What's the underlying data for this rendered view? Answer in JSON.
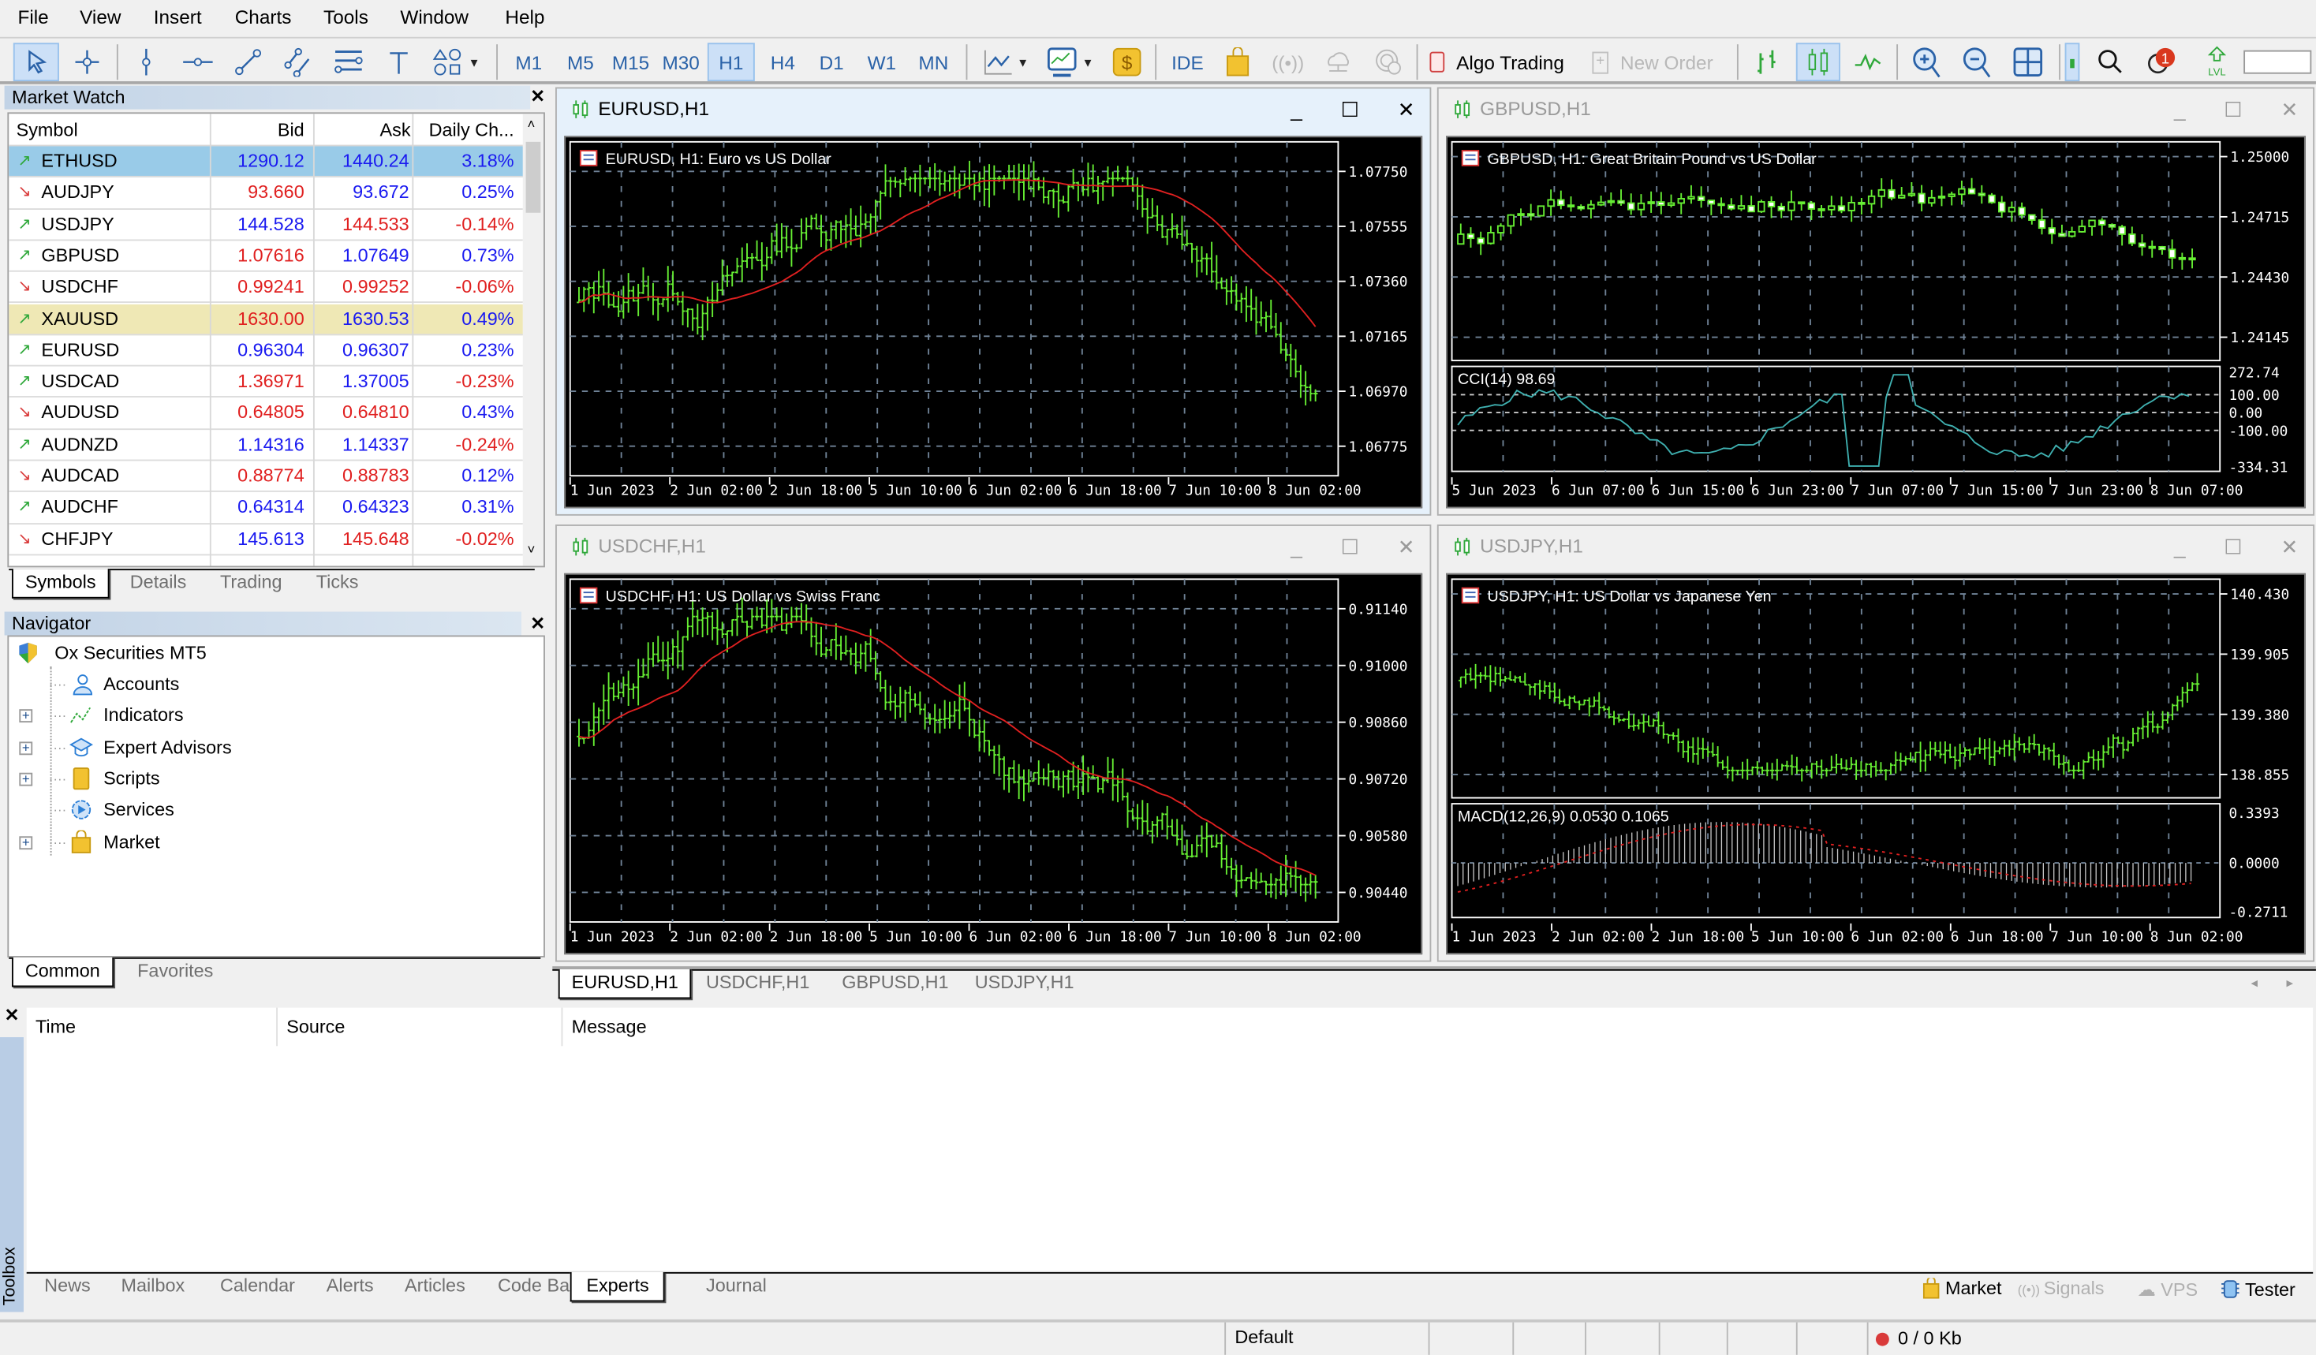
{
  "menu": [
    "File",
    "View",
    "Insert",
    "Charts",
    "Tools",
    "Window",
    "Help"
  ],
  "toolbar": {
    "timeframes": [
      "M1",
      "M5",
      "M15",
      "M30",
      "H1",
      "H4",
      "D1",
      "W1",
      "MN"
    ],
    "selected_timeframe": "H1",
    "ide_label": "IDE",
    "algo_trading_label": "Algo Trading",
    "new_order_label": "New Order",
    "notification_count": "1"
  },
  "market_watch": {
    "title": "Market Watch",
    "columns": [
      "Symbol",
      "Bid",
      "Ask",
      "Daily Ch..."
    ],
    "rows": [
      {
        "symbol": "ETHUSD",
        "dir": "up",
        "bid": "1290.12",
        "bid_c": "blue",
        "ask": "1440.24",
        "ask_c": "blue",
        "chg": "3.18%",
        "chg_c": "blue",
        "hl": "selected"
      },
      {
        "symbol": "AUDJPY",
        "dir": "down",
        "bid": "93.660",
        "bid_c": "red",
        "ask": "93.672",
        "ask_c": "blue",
        "chg": "0.25%",
        "chg_c": "blue",
        "hl": ""
      },
      {
        "symbol": "USDJPY",
        "dir": "up",
        "bid": "144.528",
        "bid_c": "blue",
        "ask": "144.533",
        "ask_c": "red",
        "chg": "-0.14%",
        "chg_c": "red",
        "hl": ""
      },
      {
        "symbol": "GBPUSD",
        "dir": "up",
        "bid": "1.07616",
        "bid_c": "red",
        "ask": "1.07649",
        "ask_c": "blue",
        "chg": "0.73%",
        "chg_c": "blue",
        "hl": ""
      },
      {
        "symbol": "USDCHF",
        "dir": "down",
        "bid": "0.99241",
        "bid_c": "red",
        "ask": "0.99252",
        "ask_c": "red",
        "chg": "-0.06%",
        "chg_c": "red",
        "hl": ""
      },
      {
        "symbol": "XAUUSD",
        "dir": "up",
        "bid": "1630.00",
        "bid_c": "red",
        "ask": "1630.53",
        "ask_c": "blue",
        "chg": "0.49%",
        "chg_c": "blue",
        "hl": "yellow"
      },
      {
        "symbol": "EURUSD",
        "dir": "up",
        "bid": "0.96304",
        "bid_c": "blue",
        "ask": "0.96307",
        "ask_c": "blue",
        "chg": "0.23%",
        "chg_c": "blue",
        "hl": ""
      },
      {
        "symbol": "USDCAD",
        "dir": "up",
        "bid": "1.36971",
        "bid_c": "red",
        "ask": "1.37005",
        "ask_c": "blue",
        "chg": "-0.23%",
        "chg_c": "red",
        "hl": ""
      },
      {
        "symbol": "AUDUSD",
        "dir": "down",
        "bid": "0.64805",
        "bid_c": "red",
        "ask": "0.64810",
        "ask_c": "red",
        "chg": "0.43%",
        "chg_c": "blue",
        "hl": ""
      },
      {
        "symbol": "AUDNZD",
        "dir": "up",
        "bid": "1.14316",
        "bid_c": "blue",
        "ask": "1.14337",
        "ask_c": "blue",
        "chg": "-0.24%",
        "chg_c": "red",
        "hl": ""
      },
      {
        "symbol": "AUDCAD",
        "dir": "down",
        "bid": "0.88774",
        "bid_c": "red",
        "ask": "0.88783",
        "ask_c": "red",
        "chg": "0.12%",
        "chg_c": "blue",
        "hl": ""
      },
      {
        "symbol": "AUDCHF",
        "dir": "up",
        "bid": "0.64314",
        "bid_c": "blue",
        "ask": "0.64323",
        "ask_c": "blue",
        "chg": "0.31%",
        "chg_c": "blue",
        "hl": ""
      },
      {
        "symbol": "CHFJPY",
        "dir": "down",
        "bid": "145.613",
        "bid_c": "blue",
        "ask": "145.648",
        "ask_c": "red",
        "chg": "-0.02%",
        "chg_c": "red",
        "hl": ""
      }
    ],
    "tabs": [
      "Symbols",
      "Details",
      "Trading",
      "Ticks"
    ],
    "active_tab": "Symbols"
  },
  "navigator": {
    "title": "Navigator",
    "root": "Ox Securities MT5",
    "items": [
      {
        "label": "Accounts",
        "expandable": false,
        "icon": "accounts-icon"
      },
      {
        "label": "Indicators",
        "expandable": true,
        "icon": "indicators-icon"
      },
      {
        "label": "Expert Advisors",
        "expandable": true,
        "icon": "expert-advisors-icon"
      },
      {
        "label": "Scripts",
        "expandable": true,
        "icon": "scripts-icon"
      },
      {
        "label": "Services",
        "expandable": false,
        "icon": "services-icon"
      },
      {
        "label": "Market",
        "expandable": true,
        "icon": "market-icon"
      }
    ],
    "tabs": [
      "Common",
      "Favorites"
    ],
    "active_tab": "Common"
  },
  "charts": [
    {
      "window_title": "EURUSD,H1",
      "active": true,
      "legend": "EURUSD, H1:  Euro vs US Dollar",
      "price_ticks": [
        "1.07750",
        "1.07555",
        "1.07360",
        "1.07165",
        "1.06970",
        "1.06775"
      ],
      "time_ticks": [
        "1 Jun 2023",
        "2 Jun 02:00",
        "2 Jun 18:00",
        "5 Jun 10:00",
        "6 Jun 02:00",
        "6 Jun 18:00",
        "7 Jun 10:00",
        "8 Jun 02:00"
      ],
      "style": "bars",
      "ma": true
    },
    {
      "window_title": "GBPUSD,H1",
      "active": false,
      "legend": "GBPUSD, H1:  Great Britain Pound vs US Dollar",
      "price_ticks": [
        "1.25000",
        "1.24715",
        "1.24430",
        "1.24145"
      ],
      "time_ticks": [
        "5 Jun 2023",
        "6 Jun 07:00",
        "6 Jun 15:00",
        "6 Jun 23:00",
        "7 Jun 07:00",
        "7 Jun 15:00",
        "7 Jun 23:00",
        "8 Jun 07:00"
      ],
      "style": "candles",
      "ma": false,
      "indicator": {
        "label": "CCI(14) 98.69",
        "ticks": [
          "272.74",
          "100.00",
          "0.00",
          "-100.00",
          "-334.31"
        ],
        "type": "cci"
      }
    },
    {
      "window_title": "USDCHF,H1",
      "active": false,
      "legend": "USDCHF, H1:  US Dollar vs Swiss Franc",
      "price_ticks": [
        "0.91140",
        "0.91000",
        "0.90860",
        "0.90720",
        "0.90580",
        "0.90440"
      ],
      "time_ticks": [
        "1 Jun 2023",
        "2 Jun 02:00",
        "2 Jun 18:00",
        "5 Jun 10:00",
        "6 Jun 02:00",
        "6 Jun 18:00",
        "7 Jun 10:00",
        "8 Jun 02:00"
      ],
      "style": "bars",
      "ma": true
    },
    {
      "window_title": "USDJPY,H1",
      "active": false,
      "legend": "USDJPY, H1:  US Dollar vs Japanese Yen",
      "price_ticks": [
        "140.430",
        "139.905",
        "139.380",
        "138.855"
      ],
      "time_ticks": [
        "1 Jun 2023",
        "2 Jun 02:00",
        "2 Jun 18:00",
        "5 Jun 10:00",
        "6 Jun 02:00",
        "6 Jun 18:00",
        "7 Jun 10:00",
        "8 Jun 02:00"
      ],
      "style": "bars",
      "ma": false,
      "indicator": {
        "label": "MACD(12,26,9) 0.0530 0.1065",
        "ticks": [
          "0.3393",
          "0.0000",
          "-0.2711"
        ],
        "type": "macd"
      }
    }
  ],
  "chart_tabs": [
    "EURUSD,H1",
    "USDCHF,H1",
    "GBPUSD,H1",
    "USDJPY,H1"
  ],
  "active_chart_tab": "EURUSD,H1",
  "toolbox": {
    "side_label": "Toolbox",
    "columns": [
      "Time",
      "Source",
      "Message"
    ],
    "tabs": [
      "News",
      "Mailbox",
      "Calendar",
      "Alerts",
      "Articles",
      "Code Base",
      "Experts",
      "Journal"
    ],
    "active_tab": "Experts",
    "right_links": [
      "Market",
      "Signals",
      "VPS",
      "Tester"
    ]
  },
  "status": {
    "profile": "Default",
    "traffic": "0 / 0 Kb"
  }
}
